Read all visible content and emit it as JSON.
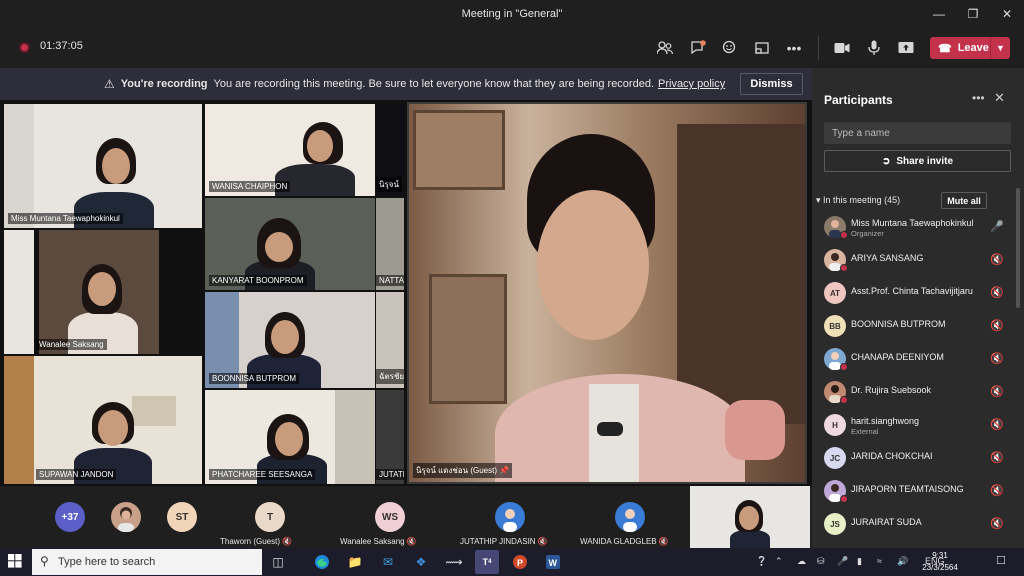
{
  "window": {
    "title": "Meeting in \"General\""
  },
  "toolbar": {
    "timer": "01:37:05",
    "leave_label": "Leave"
  },
  "banner": {
    "title": "You're recording",
    "message": "You are recording this meeting. Be sure to let everyone know that they are being recorded.",
    "link": "Privacy policy",
    "dismiss": "Dismiss"
  },
  "video_tiles": [
    {
      "name": "Miss Muntana Taewaphokinkul"
    },
    {
      "name": "WANISA CHAIPHON"
    },
    {
      "name": "KANYARAT BOONPROM"
    },
    {
      "name": "Wanalee Saksang"
    },
    {
      "name": "BOONNISA BUTPROM"
    },
    {
      "name": "SUPAWAN JANDON"
    },
    {
      "name": "PHATCHAREE SEESANGA"
    },
    {
      "name": "NATTA"
    },
    {
      "name": "JUTATH"
    },
    {
      "name": "ฉัตรชัย"
    },
    {
      "name": "นิรุจน์"
    }
  ],
  "spotlight": {
    "name": "นิรุจน์ แดงช่อน (Guest)"
  },
  "bottom_row": {
    "more_count": "+37",
    "items": [
      {
        "initials": "ST",
        "name": "",
        "color": "#f2d4b8"
      },
      {
        "initials": "T",
        "name": "Thaworn (Guest)",
        "color": "#ead9c8"
      },
      {
        "initials": "WS",
        "name": "Wanalee Saksang",
        "color": "#f0cfd6"
      },
      {
        "initials": "",
        "name": "JUTATHIP JINDASIN",
        "color": "#3a7bd5"
      },
      {
        "initials": "",
        "name": "WANIDA GLADGLEB",
        "color": "#3a7bd5"
      }
    ]
  },
  "sidebar": {
    "title": "Participants",
    "search_placeholder": "Type a name",
    "share_label": "Share invite",
    "in_meeting": "In this meeting (45)",
    "mute_all": "Mute all",
    "participants": [
      {
        "initials": "",
        "name": "Miss Muntana Taewaphokinkul",
        "sub": "Organizer",
        "color": "#8a7a6a"
      },
      {
        "initials": "",
        "name": "ARIYA SANSANG",
        "sub": "",
        "color": "#d9b5a0"
      },
      {
        "initials": "AT",
        "name": "Asst.Prof. Chinta Tachavijitjaru",
        "sub": "",
        "color": "#f0c7c0"
      },
      {
        "initials": "BB",
        "name": "BOONNISA BUTPROM",
        "sub": "",
        "color": "#f0e0b8"
      },
      {
        "initials": "",
        "name": "CHANAPA DEENIYOM",
        "sub": "",
        "color": "#7fa8d0"
      },
      {
        "initials": "",
        "name": "Dr. Rujira Suebsook",
        "sub": "",
        "color": "#c08a70"
      },
      {
        "initials": "H",
        "name": "harit.sianghwong",
        "sub": "External",
        "color": "#f0d8e0"
      },
      {
        "initials": "JC",
        "name": "JARIDA CHOKCHAI",
        "sub": "",
        "color": "#d8d8f0"
      },
      {
        "initials": "",
        "name": "JIRAPORN TEAMTAISONG",
        "sub": "",
        "color": "#c0a8d8"
      },
      {
        "initials": "JS",
        "name": "JURAIRAT SUDA",
        "sub": "",
        "color": "#e8f0c8"
      }
    ]
  },
  "taskbar": {
    "search_placeholder": "Type here to search",
    "language": "ENG",
    "time": "9:31",
    "date": "23/3/2564",
    "teams_badge": "4"
  }
}
